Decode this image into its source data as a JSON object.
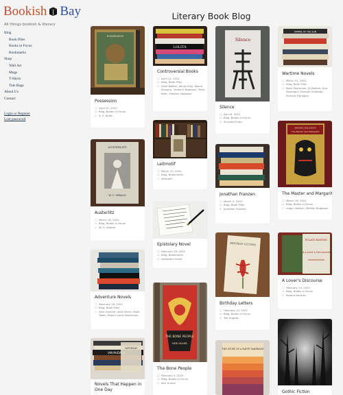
{
  "site": {
    "title_part1": "Bookish",
    "title_part2": "Bay",
    "tagline": "All things bookish & literary",
    "accent": "#c0502b",
    "brand_blue": "#2e4fa0"
  },
  "nav": [
    {
      "label": "Blog",
      "sub": false
    },
    {
      "label": "Book Piles",
      "sub": true
    },
    {
      "label": "Books in Focus",
      "sub": true
    },
    {
      "label": "Bookmarks",
      "sub": true
    },
    {
      "label": "Shop",
      "sub": false
    },
    {
      "label": "Wall Art",
      "sub": true
    },
    {
      "label": "Mugs",
      "sub": true
    },
    {
      "label": "T-Shirts",
      "sub": true
    },
    {
      "label": "Tote Bags",
      "sub": true
    },
    {
      "label": "About Us",
      "sub": false
    },
    {
      "label": "Contact",
      "sub": false
    }
  ],
  "auth": {
    "login": "Login or Register",
    "lost": "Lost password"
  },
  "page_title": "Literary Book Blog",
  "icons": {
    "date": "calendar-icon",
    "category": "folder-icon",
    "tags": "tag-icon"
  },
  "posts": [
    {
      "title": "Possession",
      "date": "April 20, 2022",
      "cat": "Blog, Books in Focus",
      "tags": "A. S. Byatt"
    },
    {
      "title": "Controversial Books",
      "date": "April 14, 2022",
      "cat": "Blog, Book Piles",
      "tags": "Alice Walker, James Frey, Kazuo Ishiguro, Vladimir Nabokov, Philip Roth, Vladimir Nabokov"
    },
    {
      "title": "Silence",
      "date": "April 8, 2022",
      "cat": "Blog, Books in Focus",
      "tags": "Shusaku Endo"
    },
    {
      "title": "Wartime Novels",
      "date": "March 31, 2022",
      "cat": "Blog, Book Piles",
      "tags": "Boris Pasternak, JG Ballard, Kurt Vonnegut, Michael Ondaatje, Richard Flanagan"
    },
    {
      "title": "Austerlitz",
      "date": "March 18, 2022",
      "cat": "Blog, Books in Focus",
      "tags": "W. G. Sebald"
    },
    {
      "title": "Leitmotif",
      "date": "March 10, 2022",
      "cat": "Blog, Bookmarks",
      "tags": "leitmotif"
    },
    {
      "title": "Jonathan Franzen",
      "date": "March 3, 2022",
      "cat": "Blog, Book Piles",
      "tags": "Jonathan Franzen"
    },
    {
      "title": "The Master and Margarita",
      "date": "March 16, 2022",
      "cat": "Blog, Books in Focus",
      "tags": "magic realism, Mikhail Bulgakov"
    },
    {
      "title": "Epistolary Novel",
      "date": "February 28, 2022",
      "cat": "Blog, Bookmarks",
      "tags": "epistolary novel"
    },
    {
      "title": "Adventure Novels",
      "date": "February 18, 2022",
      "cat": "Blog, Book Piles",
      "tags": "Alex Garland, Jules Verne, Mark Twain, Robert Louis Stevenson"
    },
    {
      "title": "Birthday Letters",
      "date": "February 10, 2022",
      "cat": "Blog, Books in Focus",
      "tags": "Ted Hughes"
    },
    {
      "title": "A Lover's Discourse",
      "date": "February 14, 2022",
      "cat": "Blog, Books in Focus",
      "tags": "Roland Barthes"
    },
    {
      "title": "The Bone People",
      "date": "February 3, 2022",
      "cat": "Blog, Books in Focus",
      "tags": "Keri Hulme"
    },
    {
      "title": "Novels That Happen in One Day",
      "date": "",
      "cat": "",
      "tags": ""
    },
    {
      "title": "Gothic Fiction",
      "date": "",
      "cat": "",
      "tags": ""
    }
  ],
  "covers": {
    "possession_label": "POSSESSION",
    "silence_title": "Silence",
    "austerlitz_title": "AUSTERLITZ",
    "austerlitz_author": "W. G. SEBALD",
    "master_title": "The Master and Margarita",
    "master_author": "MIKHAIL BULGAKOV",
    "lover_author": "ROLAND BARTHES",
    "lover_title": "A Lover's Discourse",
    "bone_title": "THE BONE PEOPLE",
    "bone_author": "KERI HULME",
    "birthday_title": "BIRTHDAY LETTERS",
    "story_title": "THE STORY OF A HAPPY MARRIAGE",
    "mcewan_label": "IAN McEWAN",
    "saturday_label": "SATURDAY",
    "lolita_label": "LOLITA",
    "wartime_label": "EMPIRE OF THE SUN"
  }
}
